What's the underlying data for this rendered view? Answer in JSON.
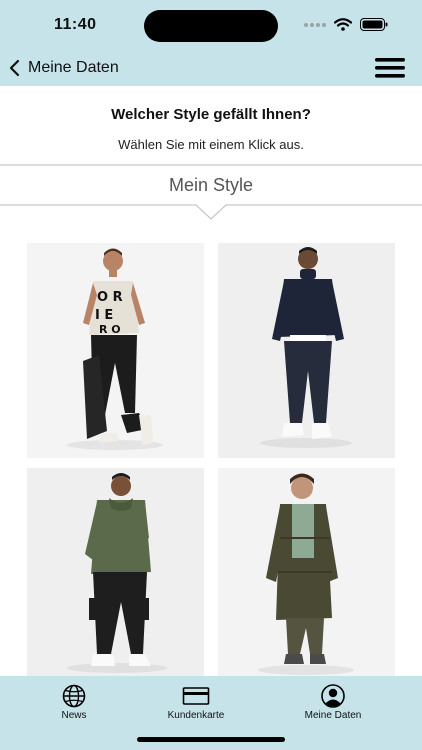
{
  "status_bar": {
    "time": "11:40"
  },
  "nav": {
    "back_label": "Meine Daten",
    "back_icon": "chevron-left-icon",
    "menu_icon": "hamburger-menu-icon"
  },
  "content": {
    "heading": "Welcher Style gefällt Ihnen?",
    "subheading": "Wählen Sie mit einem Klick aus.",
    "section_title": "Mein Style"
  },
  "styles": [
    {
      "description": "T-shirt with black letter print, black trousers, jacket in hand"
    },
    {
      "description": "Navy turtleneck sweater, navy trousers, white sneakers"
    },
    {
      "description": "Olive hoodie, black cargo trousers, white sneakers"
    },
    {
      "description": "Olive long parka, green sweater, olive trousers"
    }
  ],
  "tab_bar": {
    "tabs": [
      {
        "label": "News",
        "icon": "globe-icon"
      },
      {
        "label": "Kundenkarte",
        "icon": "card-icon"
      },
      {
        "label": "Meine Daten",
        "icon": "user-icon"
      }
    ]
  },
  "colors": {
    "bar_background": "#c6e3ea",
    "tile_background": "#f2f2f2"
  }
}
